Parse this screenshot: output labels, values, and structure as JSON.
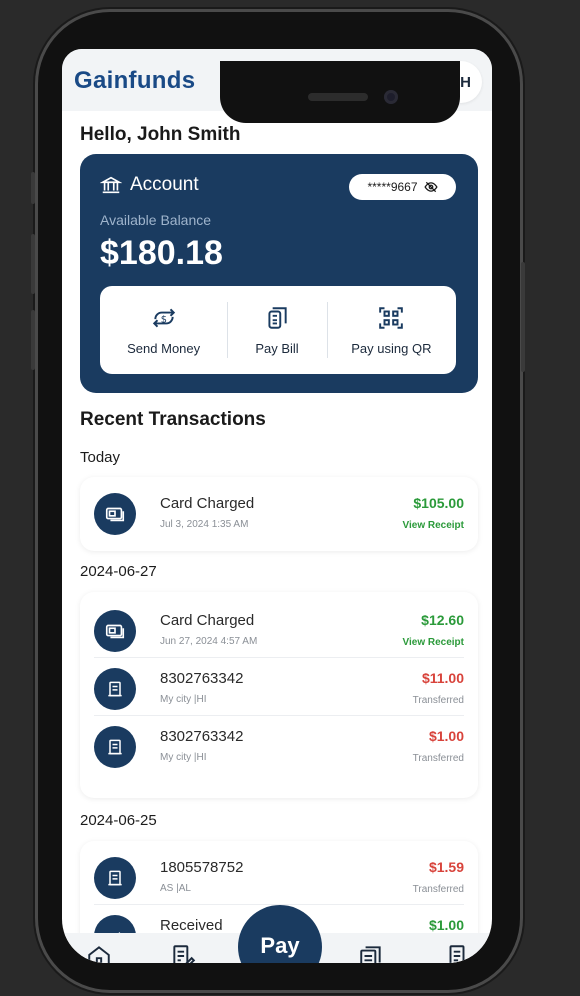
{
  "app": {
    "logo": "Gainfunds",
    "avatar_initials": "TH"
  },
  "greeting": "Hello, John Smith",
  "account": {
    "title": "Account",
    "masked_number": "*****9667",
    "balance_label": "Available Balance",
    "balance": "$180.18"
  },
  "actions": [
    {
      "label": "Send Money",
      "icon": "send-money-icon"
    },
    {
      "label": "Pay Bill",
      "icon": "pay-bill-icon"
    },
    {
      "label": "Pay using QR",
      "icon": "qr-icon"
    }
  ],
  "recent_title": "Recent Transactions",
  "groups": [
    {
      "label": "Today",
      "transactions": [
        {
          "title": "Card Charged",
          "subtitle": "Jul 3, 2024 1:35 AM",
          "amount": "$105.00",
          "meta": "View Receipt"
        }
      ]
    },
    {
      "label": "2024-06-27",
      "transactions": [
        {
          "title": "Card Charged",
          "subtitle": "Jun 27, 2024 4:57 AM",
          "amount": "$12.60",
          "meta": "View Receipt"
        },
        {
          "title": "8302763342",
          "subtitle": "My city |HI",
          "amount": "$11.00",
          "meta": "Transferred"
        },
        {
          "title": "8302763342",
          "subtitle": "My city |HI",
          "amount": "$1.00",
          "meta": "Transferred"
        }
      ]
    },
    {
      "label": "2024-06-25",
      "transactions": [
        {
          "title": "1805578752",
          "subtitle": "AS |AL",
          "amount": "$1.59",
          "meta": "Transferred"
        },
        {
          "title": "Received",
          "subtitle": "",
          "amount": "$1.00",
          "meta": ""
        }
      ]
    }
  ],
  "pay_button": "Pay",
  "colors": {
    "primary": "#1a3b60",
    "positive": "#2b9a3a",
    "negative": "#d8433b",
    "logo": "#1a4a86"
  }
}
